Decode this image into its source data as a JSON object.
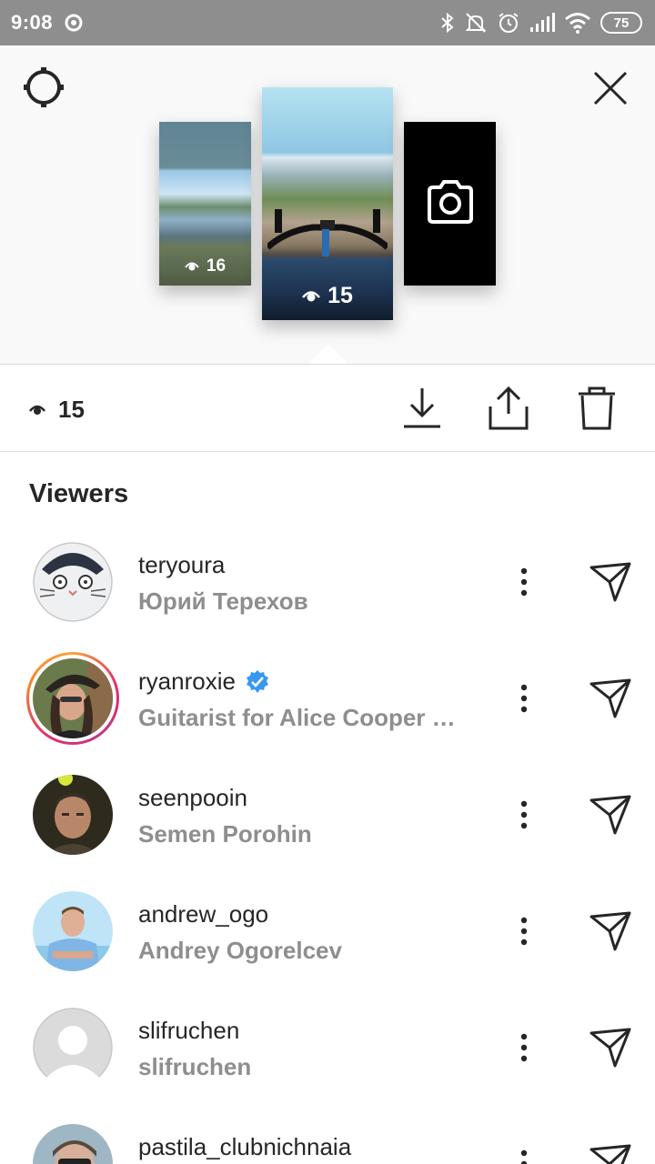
{
  "status_bar": {
    "time": "9:08",
    "battery": "75"
  },
  "stories": [
    {
      "views": "16",
      "kind": "photo"
    },
    {
      "views": "15",
      "kind": "photo",
      "selected": true
    },
    {
      "kind": "camera"
    }
  ],
  "action_bar": {
    "view_count": "15"
  },
  "viewers": {
    "title": "Viewers",
    "items": [
      {
        "username": "teryoura",
        "full_name": "Юрий Терехов",
        "verified": false,
        "has_story_ring": false,
        "avatar": "cartoon-cat"
      },
      {
        "username": "ryanroxie",
        "full_name": "Guitarist for Alice Cooper …",
        "verified": true,
        "has_story_ring": true,
        "avatar": "photo"
      },
      {
        "username": "seenpooin",
        "full_name": "Semen Porohin",
        "verified": false,
        "has_story_ring": false,
        "avatar": "photo"
      },
      {
        "username": "andrew_ogo",
        "full_name": "Andrey Ogorelcev",
        "verified": false,
        "has_story_ring": false,
        "avatar": "photo"
      },
      {
        "username": "slifruchen",
        "full_name": "slifruchen",
        "verified": false,
        "has_story_ring": false,
        "avatar": "default"
      },
      {
        "username": "pastila_clubnichnaia",
        "full_name": "",
        "verified": false,
        "has_story_ring": false,
        "avatar": "photo"
      }
    ]
  },
  "colors": {
    "status_bar": "#8e8e8e",
    "primary_text": "#262626",
    "secondary_text": "#8e8e8e",
    "verified_blue": "#3897f0",
    "divider": "#dbdbdb",
    "preview_background": "#f9f9f9"
  }
}
